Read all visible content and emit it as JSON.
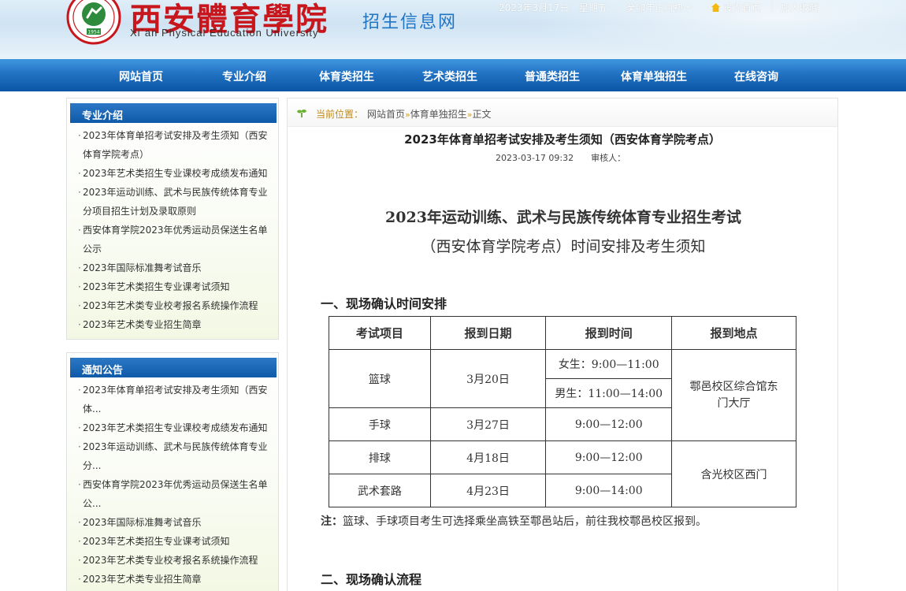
{
  "header": {
    "logo_cn": "西安體育學院",
    "logo_en": "Xi`an Physical Education University",
    "seal_year": "1954",
    "site_name": "招生信息网",
    "date": "2023年3月17日",
    "weekday": "星期五",
    "lunar": "癸卯年正月初十",
    "set_home": "设为首页",
    "separator": "|",
    "add_fav": "加入收藏"
  },
  "nav": {
    "items": [
      "网站首页",
      "专业介绍",
      "体育类招生",
      "艺术类招生",
      "普通类招生",
      "体育单独招生",
      "在线咨询"
    ]
  },
  "sidebar": {
    "box1": {
      "title": "专业介绍",
      "items": [
        "2023年体育单招考试安排及考生须知（西安体育学院考点）",
        "2023年艺术类招生专业课校考成绩发布通知",
        "2023年运动训练、武术与民族传统体育专业分项目招生计划及录取原则",
        "西安体育学院2023年优秀运动员保送生名单公示",
        "2023年国际标准舞考试音乐",
        "2023年艺术类招生专业课考试须知",
        "2023年艺术类专业校考报名系统操作流程",
        "2023年艺术类专业招生简章"
      ]
    },
    "box2": {
      "title": "通知公告",
      "items": [
        "2023年体育单招考试安排及考生须知（西安体...",
        "2023年艺术类招生专业课校考成绩发布通知",
        "2023年运动训练、武术与民族传统体育专业分...",
        "西安体育学院2023年优秀运动员保送生名单公...",
        "2023年国际标准舞考试音乐",
        "2023年艺术类招生专业课考试须知",
        "2023年艺术类专业校考报名系统操作流程",
        "2023年艺术类专业招生简章"
      ]
    }
  },
  "breadcrumb": {
    "label": "当前位置：",
    "home": "网站首页",
    "sep": "»",
    "section": "体育单独招生",
    "current": "正文"
  },
  "article": {
    "title": "2023年体育单招考试安排及考生须知（西安体育学院考点）",
    "date": "2023-03-17 09:32",
    "reviewer": "审核人：",
    "head1": "2023年运动训练、武术与民族传统体育专业招生考试",
    "head2": "（西安体育学院考点）时间安排及考生须知",
    "section1": "一、现场确认时间安排",
    "section2": "二、现场确认流程",
    "table": {
      "headers": [
        "考试项目",
        "报到日期",
        "报到时间",
        "报到地点"
      ],
      "basketball": "篮球",
      "basketball_date": "3月20日",
      "basketball_female": "女生：9:00—11:00",
      "basketball_male": "男生：11:00—14:00",
      "location1": "鄠邑校区综合馆东门大厅",
      "handball": "手球",
      "handball_date": "3月27日",
      "handball_time": "9:00—12:00",
      "volleyball": "排球",
      "volleyball_date": "4月18日",
      "volleyball_time": "9:00—12:00",
      "location2": "含光校区西门",
      "wushu": "武术套路",
      "wushu_date": "4月23日",
      "wushu_time": "9:00—14:00"
    },
    "note_label": "注：",
    "note": "篮球、手球项目考生可选择乘坐高铁至鄠邑站后，前往我校鄠邑校区报到。"
  }
}
